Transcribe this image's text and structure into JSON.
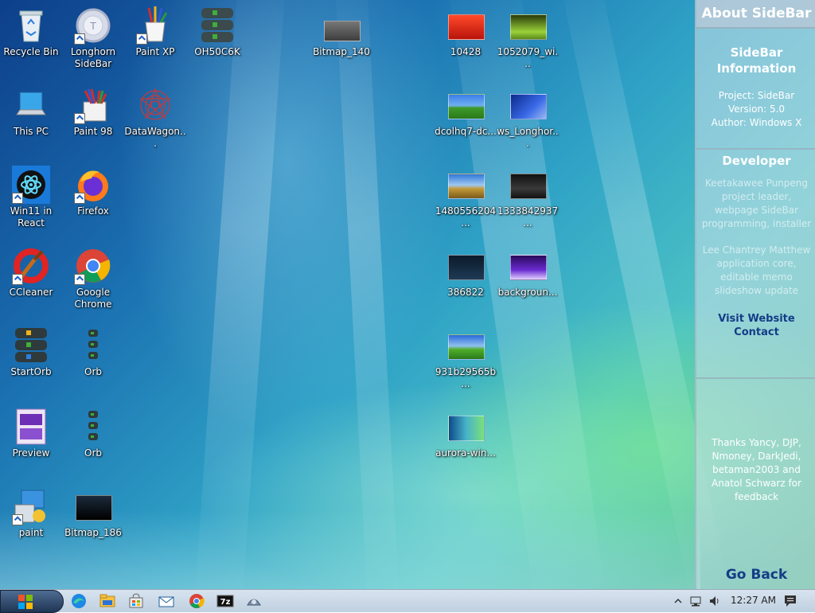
{
  "desktop": {
    "icons": [
      {
        "label": "Recycle Bin"
      },
      {
        "label": "Longhorn SideBar"
      },
      {
        "label": "Paint XP"
      },
      {
        "label": "OH50C6K"
      },
      {
        "label": "Bitmap_140"
      },
      {
        "label": "10428"
      },
      {
        "label": "1052079_wi..."
      },
      {
        "label": "This PC"
      },
      {
        "label": "Paint 98"
      },
      {
        "label": "DataWagon..."
      },
      {
        "label": "dcolhq7-dc..."
      },
      {
        "label": "ws_Longhor..."
      },
      {
        "label": "Win11 in React"
      },
      {
        "label": "Firefox"
      },
      {
        "label": "1480556204..."
      },
      {
        "label": "1333842937..."
      },
      {
        "label": "CCleaner"
      },
      {
        "label": "Google Chrome"
      },
      {
        "label": "386822"
      },
      {
        "label": "backgroun..."
      },
      {
        "label": "StartOrb"
      },
      {
        "label": "Orb"
      },
      {
        "label": "931b29565b..."
      },
      {
        "label": "Preview"
      },
      {
        "label": "Orb"
      },
      {
        "label": "aurora-win..."
      },
      {
        "label": "paint"
      },
      {
        "label": "Bitmap_186"
      }
    ]
  },
  "sidebar": {
    "header": "About SideBar",
    "info_title": "SideBar Information",
    "info_lines": [
      "Project: SideBar",
      "Version: 5.0",
      "Author: Windows X"
    ],
    "dev_title": "Developer",
    "dev1": "Keetakawee Punpeng project leader, webpage SideBar programming, installer",
    "dev2": "Lee Chantrey Matthew application core, editable memo slideshow update",
    "visit": "Visit Website",
    "contact": "Contact",
    "thanks": "Thanks Yancy, DJP, Nmoney, DarkJedi, betaman2003 and Anatol Schwarz for feedback",
    "go_back": "Go Back"
  },
  "taskbar": {
    "pinned": [
      "edge-icon",
      "file-explorer-icon",
      "store-icon",
      "mail-icon",
      "chrome-icon",
      "7zip-icon",
      "app-icon"
    ],
    "time": "12:27 AM"
  },
  "colors": {
    "sidebar_link": "#143c86",
    "desktop_mid": "#2fa2c6"
  }
}
